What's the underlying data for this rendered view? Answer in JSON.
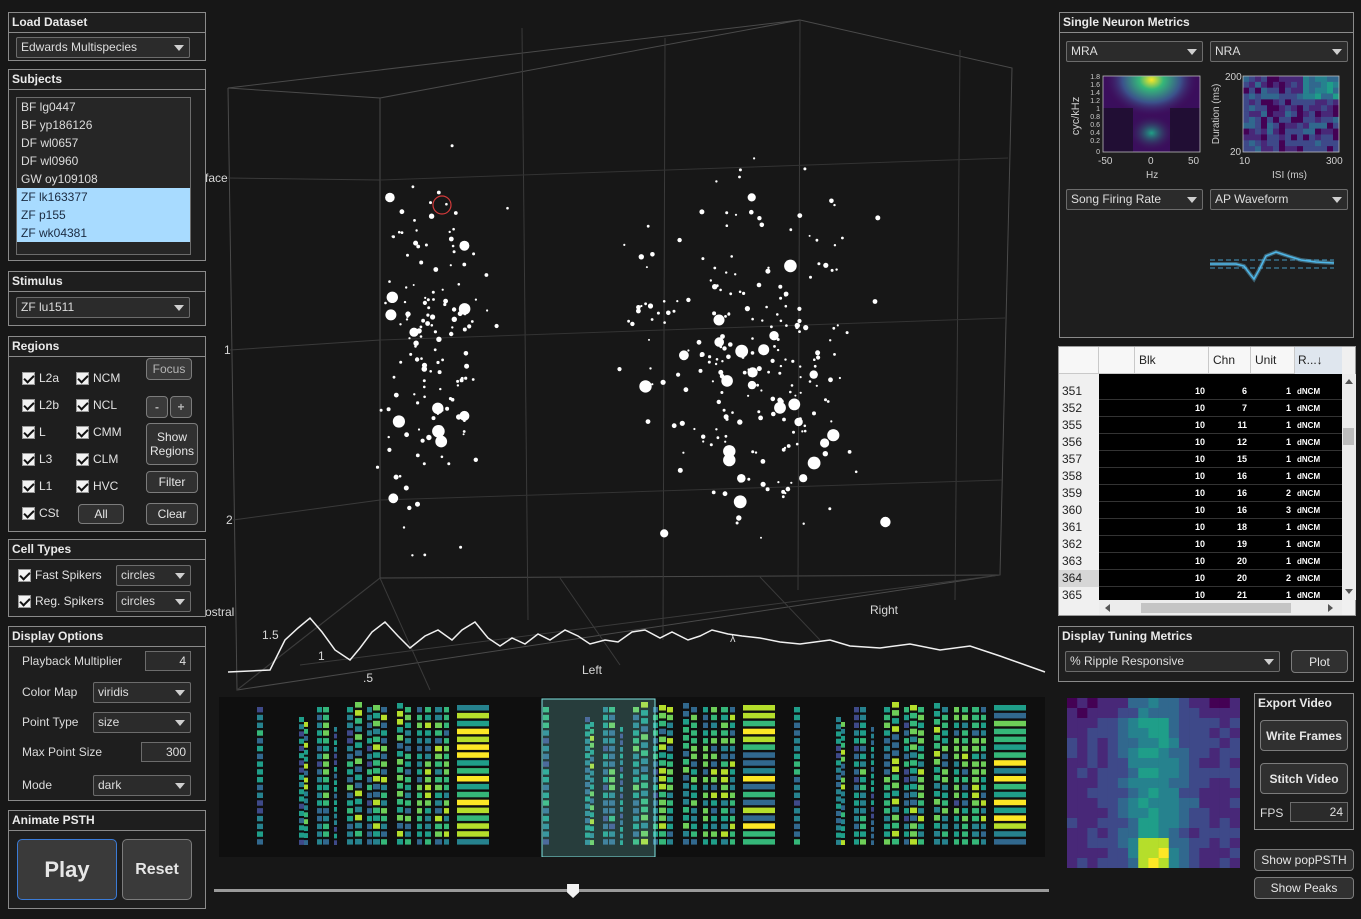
{
  "load_dataset": {
    "title": "Load Dataset",
    "value": "Edwards Multispecies"
  },
  "subjects": {
    "title": "Subjects",
    "items": [
      "BF lg0447",
      "BF yp186126",
      "DF wl0657",
      "DF wl0960",
      "GW oy109108",
      "ZF lk163377",
      "ZF p155",
      "ZF wk04381"
    ],
    "selected": [
      5,
      6,
      7
    ]
  },
  "stimulus": {
    "title": "Stimulus",
    "value": "ZF lu1511"
  },
  "regions": {
    "title": "Regions",
    "col1": [
      "L2a",
      "L2b",
      "L",
      "L3",
      "L1",
      "CSt"
    ],
    "col2": [
      "NCM",
      "NCL",
      "CMM",
      "CLM",
      "HVC"
    ],
    "focus": "Focus",
    "minus": "-",
    "plus": "+",
    "show_regions": "Show Regions",
    "filter": "Filter",
    "all": "All",
    "clear": "Clear"
  },
  "cell_types": {
    "title": "Cell Types",
    "fast_label": "Fast Spikers",
    "fast_shape": "circles",
    "reg_label": "Reg. Spikers",
    "reg_shape": "circles"
  },
  "display_options": {
    "title": "Display Options",
    "playback_label": "Playback Multiplier",
    "playback_value": "4",
    "colormap_label": "Color Map",
    "colormap_value": "viridis",
    "pointtype_label": "Point Type",
    "pointtype_value": "size",
    "maxsize_label": "Max Point Size",
    "maxsize_value": "300",
    "mode_label": "Mode",
    "mode_value": "dark"
  },
  "animate": {
    "title": "Animate PSTH",
    "play": "Play",
    "reset": "Reset"
  },
  "plot3d": {
    "axis_face": "face",
    "tick_1": "1",
    "tick_2": "2",
    "rostral": "ostral",
    "left": "Left",
    "right": "Right",
    "psth_ticks": [
      "1.5",
      "1",
      ".5"
    ],
    "marker": "λ"
  },
  "single_neuron": {
    "title": "Single Neuron Metrics",
    "dd1": "MRA",
    "dd2": "NRA",
    "dd3": "Song Firing Rate",
    "dd4": "AP Waveform",
    "mra_ylabel": "cyc/kHz",
    "mra_yticks": [
      "1.8",
      "1.6",
      "1.4",
      "1.2",
      "1",
      "0.8",
      "0.6",
      "0.4",
      "0.2",
      "0"
    ],
    "mra_xticks": [
      "-50",
      "0",
      "50"
    ],
    "mra_xlabel": "Hz",
    "nra_ylabel": "Duration (ms)",
    "nra_yticks": [
      "200",
      "20"
    ],
    "nra_xticks": [
      "10",
      "300"
    ],
    "nra_xlabel": "ISI (ms)"
  },
  "table": {
    "headers": [
      "Blk",
      "Chn",
      "Unit",
      "R...↓"
    ],
    "rows": [
      [
        "351",
        "10",
        "6",
        "1",
        "dNCM"
      ],
      [
        "352",
        "10",
        "7",
        "1",
        "dNCM"
      ],
      [
        "355",
        "10",
        "11",
        "1",
        "dNCM"
      ],
      [
        "356",
        "10",
        "12",
        "1",
        "dNCM"
      ],
      [
        "357",
        "10",
        "15",
        "1",
        "dNCM"
      ],
      [
        "358",
        "10",
        "16",
        "1",
        "dNCM"
      ],
      [
        "359",
        "10",
        "16",
        "2",
        "dNCM"
      ],
      [
        "360",
        "10",
        "16",
        "3",
        "dNCM"
      ],
      [
        "361",
        "10",
        "18",
        "1",
        "dNCM"
      ],
      [
        "362",
        "10",
        "19",
        "1",
        "dNCM"
      ],
      [
        "363",
        "10",
        "20",
        "1",
        "dNCM"
      ],
      [
        "364",
        "10",
        "20",
        "2",
        "dNCM"
      ],
      [
        "365",
        "10",
        "21",
        "1",
        "dNCM"
      ]
    ]
  },
  "tuning": {
    "title": "Display Tuning Metrics",
    "value": "% Ripple Responsive",
    "plot": "Plot"
  },
  "export_video": {
    "title": "Export Video",
    "write_frames": "Write Frames",
    "stitch_video": "Stitch Video",
    "fps_label": "FPS",
    "fps_value": "24"
  },
  "buttons": {
    "show_pop_psth": "Show popPSTH",
    "show_peaks": "Show Peaks"
  },
  "timeline": {
    "slider_position": 0.43
  }
}
